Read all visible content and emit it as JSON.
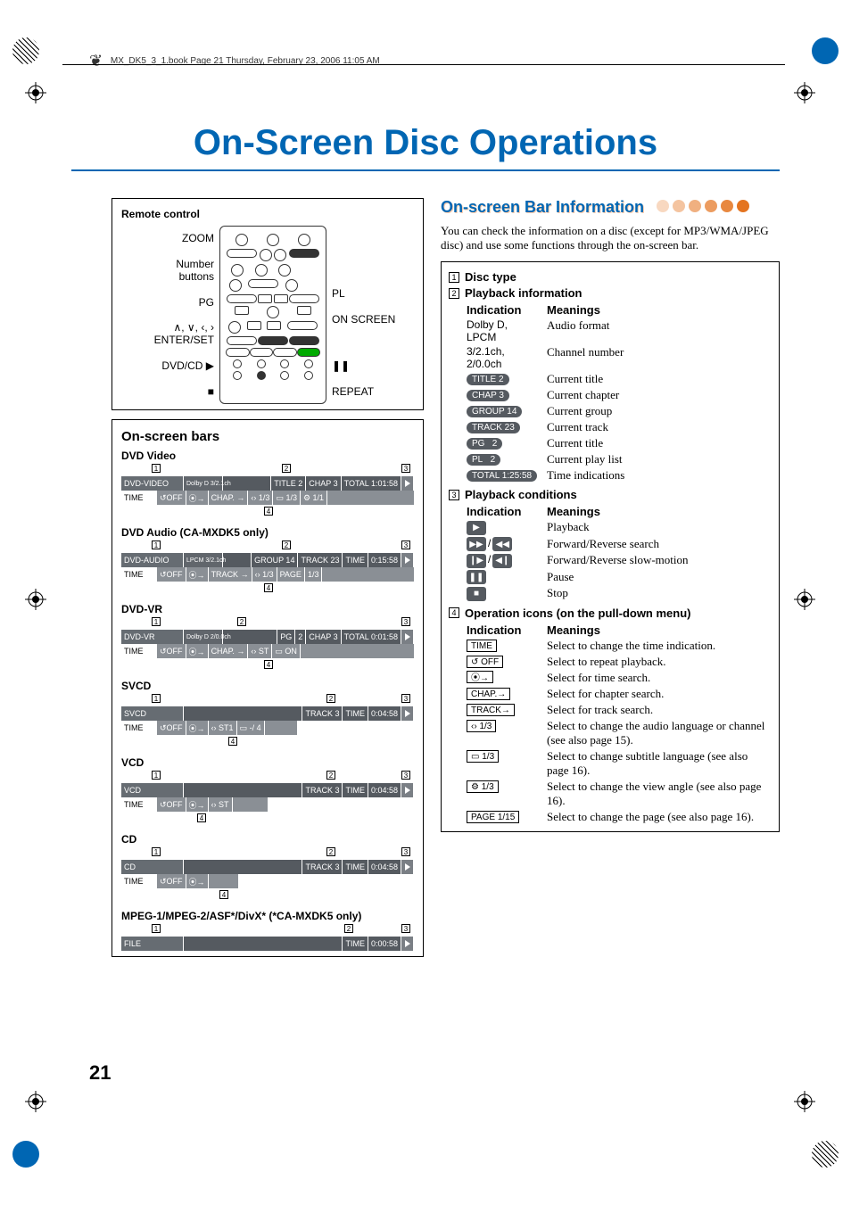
{
  "page_header": "MX_DK5_3_1.book  Page 21  Thursday, February 23, 2006  11:05 AM",
  "main_title": "On-Screen Disc Operations",
  "page_number": "21",
  "remote": {
    "label": "Remote control",
    "left": {
      "zoom": "ZOOM",
      "number_buttons_1": "Number",
      "number_buttons_2": "buttons",
      "pg": "PG",
      "arrows_enter_1": "∧, ∨, ‹, ›",
      "arrows_enter_2": "ENTER/SET",
      "dvd_cd": "DVD/CD ▶",
      "stop": "■"
    },
    "right": {
      "pl": "PL",
      "on_screen": "ON SCREEN",
      "pause": "❚❚",
      "repeat": "REPEAT"
    }
  },
  "bars_title": "On-screen bars",
  "bars": {
    "dvd_video": {
      "title": "DVD Video",
      "row1": {
        "type": "DVD-VIDEO",
        "audio": "Dolby D\n3/2.1ch",
        "title": "TITLE  2",
        "chap": "CHAP  3",
        "total": "TOTAL  1:01:58"
      },
      "row2": {
        "time": "TIME",
        "repeat": "↺OFF",
        "timesearch": "⦿→",
        "chap": "CHAP. →",
        "audio": "‹› 1/3",
        "sub": "▭ 1/3",
        "angle": "⚙ 1/1"
      }
    },
    "dvd_audio": {
      "title": "DVD Audio (CA-MXDK5 only)",
      "row1": {
        "type": "DVD-AUDIO",
        "audio": "LPCM\n3/2.1ch",
        "group": "GROUP 14",
        "track": "TRACK 23",
        "time": "TIME",
        "dur": "0:15:58"
      },
      "row2": {
        "time": "TIME",
        "repeat": "↺OFF",
        "timesearch": "⦿→",
        "track": "TRACK →",
        "audio": "‹›  1/3",
        "page": "PAGE",
        "pagenum": "1/3"
      }
    },
    "dvd_vr": {
      "title": "DVD-VR",
      "row1": {
        "type": "DVD-VR",
        "audio": "Dolby D\n2/0.0ch",
        "pg": "PG",
        "pgnum": "2",
        "chap": "CHAP  3",
        "total": "TOTAL  0:01:58"
      },
      "row2": {
        "time": "TIME",
        "repeat": "↺OFF",
        "timesearch": "⦿→",
        "chap": "CHAP. →",
        "audio": "‹› ST",
        "sub": "▭ ON"
      }
    },
    "svcd": {
      "title": "SVCD",
      "row1": {
        "type": "SVCD",
        "track": "TRACK  3",
        "time": "TIME",
        "dur": "0:04:58"
      },
      "row2": {
        "time": "TIME",
        "repeat": "↺OFF",
        "timesearch": "⦿→",
        "audio": "‹› ST1",
        "sub": "▭ -/ 4"
      }
    },
    "vcd": {
      "title": "VCD",
      "row1": {
        "type": "VCD",
        "track": "TRACK  3",
        "time": "TIME",
        "dur": "0:04:58"
      },
      "row2": {
        "time": "TIME",
        "repeat": "↺OFF",
        "timesearch": "⦿→",
        "audio": "‹› ST"
      }
    },
    "cd": {
      "title": "CD",
      "row1": {
        "type": "CD",
        "track": "TRACK  3",
        "time": "TIME",
        "dur": "0:04:58"
      },
      "row2": {
        "time": "TIME",
        "repeat": "↺OFF",
        "timesearch": "⦿→"
      }
    },
    "file": {
      "title": "MPEG-1/MPEG-2/ASF*/DivX* (*CA-MXDK5 only)",
      "row1": {
        "type": "FILE",
        "time": "TIME",
        "dur": "0:00:58"
      }
    }
  },
  "right": {
    "heading": "On-screen Bar Information",
    "intro": "You can check the information on a disc (except for MP3/WMA/JPEG disc) and use some functions through the on-screen bar.",
    "sec1": "Disc type",
    "sec2": "Playback information",
    "sec3": "Playback conditions",
    "sec4": "Operation icons (on the pull-down menu)",
    "col_ind": "Indication",
    "col_mean": "Meanings",
    "tbl2": [
      {
        "ind": "Dolby D, LPCM",
        "mean": "Audio format",
        "style": "plain"
      },
      {
        "ind": "3/2.1ch, 2/0.0ch",
        "mean": "Channel number",
        "style": "plain"
      },
      {
        "ind": "TITLE 2",
        "mean": "Current title",
        "style": "pill"
      },
      {
        "ind": "CHAP 3",
        "mean": "Current chapter",
        "style": "pill"
      },
      {
        "ind": "GROUP 14",
        "mean": "Current group",
        "style": "pill"
      },
      {
        "ind": "TRACK 23",
        "mean": "Current track",
        "style": "pill"
      },
      {
        "ind": "PG   2",
        "mean": "Current title",
        "style": "pill"
      },
      {
        "ind": "PL   2",
        "mean": "Current play list",
        "style": "pill"
      },
      {
        "ind": "TOTAL 1:25:58",
        "mean": "Time indications",
        "style": "pill"
      }
    ],
    "tbl3": [
      {
        "ind": "▶",
        "mean": "Playback",
        "style": "icon"
      },
      {
        "ind": "▶▶ / ◀◀",
        "mean": "Forward/Reverse search",
        "style": "icon2"
      },
      {
        "ind": "❙▶ / ◀❙",
        "mean": "Forward/Reverse slow-motion",
        "style": "icon2"
      },
      {
        "ind": "❚❚",
        "mean": "Pause",
        "style": "icon"
      },
      {
        "ind": "■",
        "mean": "Stop",
        "style": "icon"
      }
    ],
    "tbl4": [
      {
        "ind": "TIME",
        "mean": "Select to change the time indication.",
        "style": "box"
      },
      {
        "ind": "↺ OFF",
        "mean": "Select to repeat playback.",
        "style": "box"
      },
      {
        "ind": "⦿→",
        "mean": "Select for time search.",
        "style": "box"
      },
      {
        "ind": "CHAP.→",
        "mean": "Select for chapter search.",
        "style": "box"
      },
      {
        "ind": "TRACK→",
        "mean": "Select for track search.",
        "style": "box"
      },
      {
        "ind": "‹› 1/3",
        "mean": "Select to change the audio language or channel (see also page 15).",
        "style": "box"
      },
      {
        "ind": "▭ 1/3",
        "mean": "Select to change subtitle language (see also page 16).",
        "style": "box"
      },
      {
        "ind": "⚙ 1/3",
        "mean": "Select to change the view angle (see also page 16).",
        "style": "box"
      },
      {
        "ind": "PAGE 1/15",
        "mean": "Select to change the page (see also page 16).",
        "style": "box"
      }
    ]
  }
}
